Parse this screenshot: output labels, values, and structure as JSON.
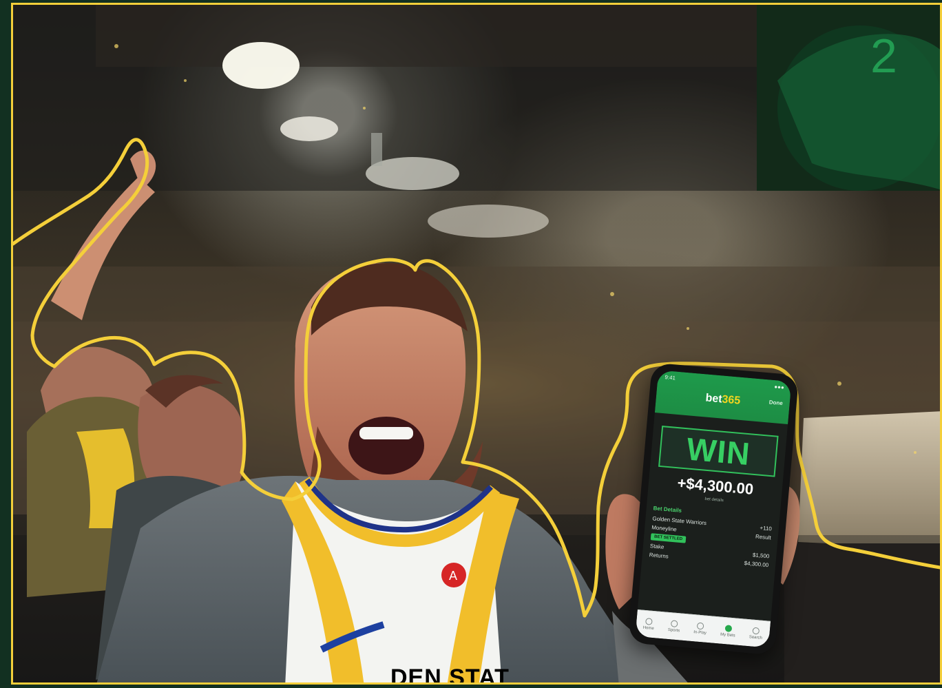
{
  "phone": {
    "status_time": "9:41",
    "brand_left": "bet",
    "brand_right": "365",
    "top_right": "Done",
    "win": "WIN",
    "amount": "+$4,300.00",
    "submeta": "bet details",
    "section_title": "Bet Details",
    "line1_left": "Golden State Warriors",
    "line1_right": "+110",
    "line2_left": "Moneyline",
    "line2_right": "Result",
    "pill": "BET SETTLED",
    "line3_left": "Stake",
    "line3_right": "$1,500",
    "line4_left": "Returns",
    "line4_right": "$4,300.00",
    "nav": [
      "Home",
      "Sports",
      "In-Play",
      "My Bets",
      "Search"
    ]
  },
  "jersey": {
    "front_text": "DEN STAT"
  },
  "colors": {
    "highlight": "#f4cf3a",
    "brand_green": "#1d8d44",
    "win_green": "#37cf63"
  }
}
